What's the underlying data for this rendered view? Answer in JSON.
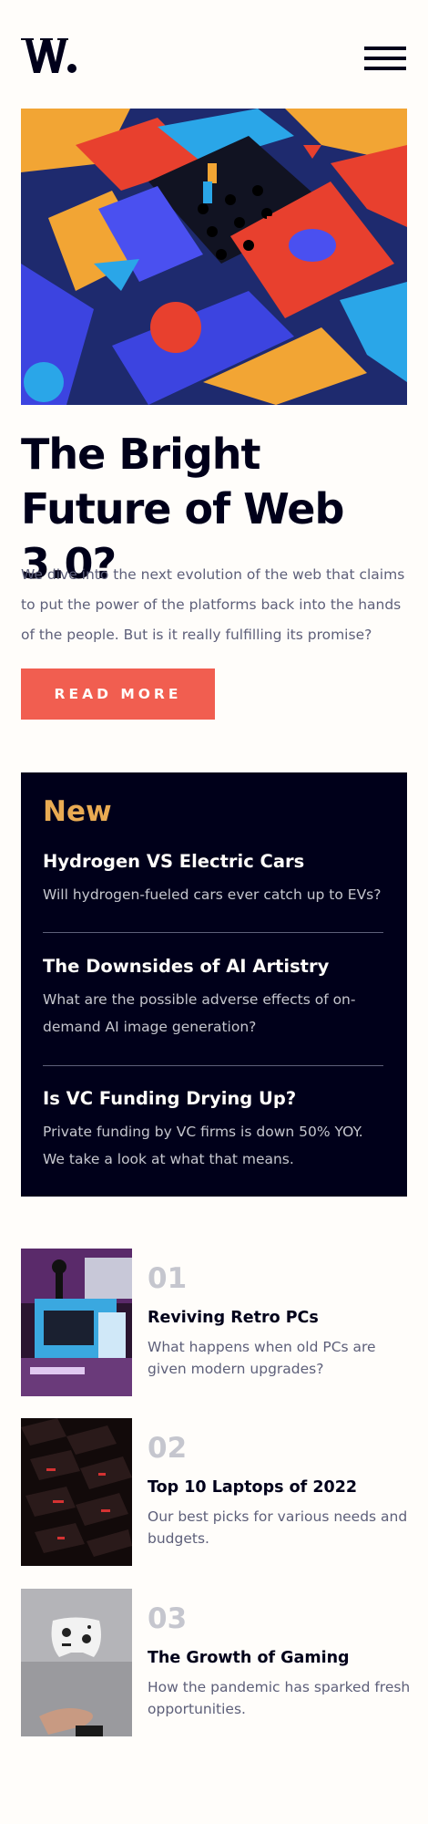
{
  "header": {
    "logo_text": "W.",
    "menu_icon": "hamburger-menu-icon"
  },
  "hero": {
    "image_icon": "abstract-3d-blocks-illustration",
    "title": "The Bright Future of Web 3.0?",
    "description": "We dive into the next evolution of the web that claims to put the power of the platforms back into the hands of the people. But is it really fulfilling its promise?",
    "cta_label": "READ MORE"
  },
  "new_panel": {
    "heading": "New",
    "items": [
      {
        "title": "Hydrogen VS Electric Cars",
        "description": "Will hydrogen-fueled cars ever catch up to EVs?"
      },
      {
        "title": "The Downsides of AI Artistry",
        "description": "What are the possible adverse effects of on-demand AI image generation?"
      },
      {
        "title": "Is VC Funding Drying Up?",
        "description": "Private funding by VC firms is down 50% YOY. We take a look at what that means."
      }
    ]
  },
  "articles": [
    {
      "number": "01",
      "title": "Reviving Retro PCs",
      "description": "What happens when old PCs are given modern upgrades?",
      "image_icon": "retro-pc-photo"
    },
    {
      "number": "02",
      "title": "Top 10 Laptops of 2022",
      "description": "Our best picks for various needs and budgets.",
      "image_icon": "laptop-keyboard-photo"
    },
    {
      "number": "03",
      "title": "The Growth of Gaming",
      "description": "How the pandemic has sparked fresh opportunities.",
      "image_icon": "game-controller-photo"
    }
  ],
  "colors": {
    "accent_red": "#f15e50",
    "accent_orange": "#e9ab53",
    "dark_navy": "#00001a",
    "grayish_blue": "#5d5f79",
    "off_white": "#fffdfa"
  }
}
